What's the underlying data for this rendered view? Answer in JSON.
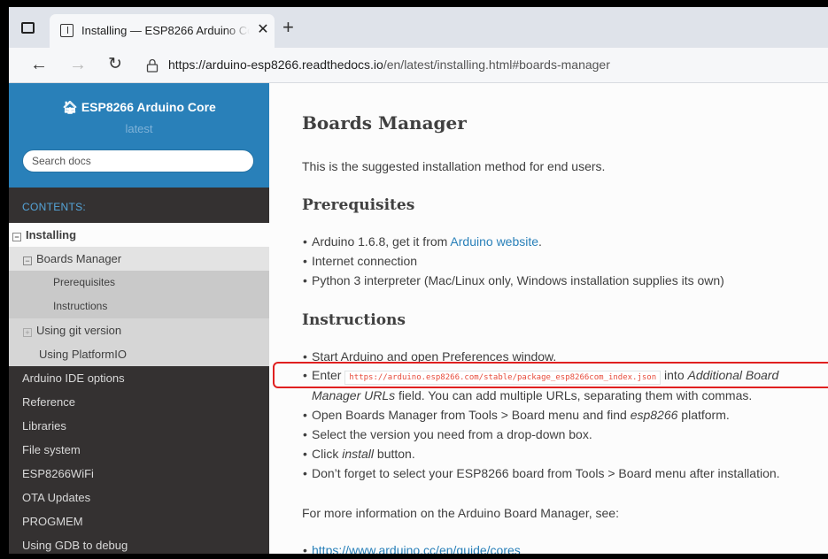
{
  "browser": {
    "tab_title": "Installing — ESP8266 Arduino Co",
    "tab_close": "✕",
    "new_tab": "+",
    "url_host": "https://arduino-esp8266.readthedocs.io",
    "url_path": "/en/latest/installing.html#boards-manager"
  },
  "sidebar": {
    "brand": "ESP8266 Arduino Core",
    "version": "latest",
    "search_placeholder": "Search docs",
    "caption": "CONTENTS:",
    "items": [
      {
        "label": "Installing",
        "toggle": "⊟"
      },
      {
        "label": "Boards Manager",
        "toggle": "⊟"
      },
      {
        "label": "Prerequisites"
      },
      {
        "label": "Instructions"
      },
      {
        "label": "Using git version",
        "toggle": "⊞"
      },
      {
        "label": "Using PlatformIO"
      },
      {
        "label": "Arduino IDE options"
      },
      {
        "label": "Reference"
      },
      {
        "label": "Libraries"
      },
      {
        "label": "File system"
      },
      {
        "label": "ESP8266WiFi"
      },
      {
        "label": "OTA Updates"
      },
      {
        "label": "PROGMEM"
      },
      {
        "label": "Using GDB to debug"
      }
    ]
  },
  "content": {
    "title": "Boards Manager",
    "intro": "This is the suggested installation method for end users.",
    "prereq_heading": "Prerequisites",
    "prereq": {
      "item1_text": "Arduino 1.6.8, get it from ",
      "item1_link": "Arduino website",
      "item1_end": ".",
      "item2": "Internet connection",
      "item3": "Python 3 interpreter (Mac/Linux only, Windows installation supplies its own)"
    },
    "instr_heading": "Instructions",
    "instr": {
      "item1": "Start Arduino and open Preferences window.",
      "item2_pre": "Enter ",
      "item2_code": "https://arduino.esp8266.com/stable/package_esp8266com_index.json",
      "item2_post": " into ",
      "item2_em1": "Additional Board",
      "item2_em2": "Manager URLs",
      "item2_rest": " field. You can add multiple URLs, separating them with commas.",
      "item3_pre": "Open Boards Manager from Tools > Board menu and find ",
      "item3_em": "esp8266",
      "item3_post": " platform.",
      "item4": "Select the version you need from a drop-down box.",
      "item5_pre": "Click ",
      "item5_em": "install",
      "item5_post": " button.",
      "item6": "Don’t forget to select your ESP8266 board from Tools > Board menu after installation."
    },
    "more_info": "For more information on the Arduino Board Manager, see:",
    "more_link": "https://www.arduino.cc/en/guide/cores"
  }
}
